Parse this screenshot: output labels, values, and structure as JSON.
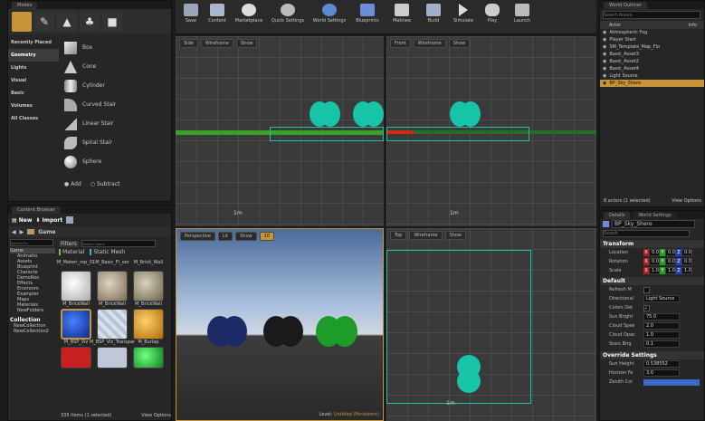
{
  "modes": {
    "title": "Modes",
    "categories": [
      "Recently Placed",
      "Geometry",
      "Lights",
      "Visual",
      "Basic",
      "Volumes",
      "All Classes"
    ],
    "selected_category": "Geometry",
    "items": [
      "Box",
      "Cone",
      "Cylinder",
      "Curved Stair",
      "Linear Stair",
      "Spiral Stair",
      "Sphere"
    ],
    "add_label": "Add",
    "subtract_label": "Subtract"
  },
  "toolbar": {
    "buttons": [
      "Save",
      "Content",
      "Marketplace",
      "Quick Settings",
      "World Settings",
      "Blueprints",
      "Matinee",
      "Build",
      "Simulate",
      "Play",
      "Launch"
    ]
  },
  "viewports": {
    "side": {
      "mode": "Side",
      "view": "Wireframe",
      "show": "Show"
    },
    "front": {
      "mode": "Front",
      "view": "Wireframe",
      "show": "Show"
    },
    "perspective": {
      "mode": "Perspective",
      "view": "Lit",
      "show": "Show",
      "snap": "10",
      "level_label": "Level:",
      "level_value": "Untitled (Persistent)"
    },
    "top": {
      "mode": "Top",
      "view": "Wireframe",
      "show": "Show"
    },
    "scale_label": "1m"
  },
  "content_browser": {
    "title": "Content Browser",
    "new_label": "New",
    "import_label": "Import",
    "path": "Game",
    "search_folders_placeholder": "Search Fo",
    "filters_label": "Filters",
    "search_assets_placeholder": "Search Game",
    "folders": [
      "Game",
      "Animatio",
      "Assets",
      "Blueprint",
      "Characte",
      "DemoRoo",
      "Effects",
      "Environm",
      "Exampler",
      "Maps",
      "Materials",
      "NewFolders"
    ],
    "collections_label": "Collection",
    "collections": [
      "NewCollection",
      "NewCollection2"
    ],
    "columns": [
      "Material",
      "Static Mesh"
    ],
    "partial_row": [
      "M_Materi_rop_01",
      "M_Basic_Fl_oor",
      "M_Brick_Wall"
    ],
    "assets": [
      {
        "name": "M_BrickWall",
        "color": "#e8e8e8"
      },
      {
        "name": "M_BrickWall",
        "color": "#c9b9a2"
      },
      {
        "name": "M_BrickWall",
        "color": "#b9b39a"
      },
      {
        "name": "M_BSP_Viz",
        "color": "#1a4bd6"
      },
      {
        "name": "M_BSP_Viz_Transpar",
        "color": "#b9c3d6"
      },
      {
        "name": "M_Burlap",
        "color": "#f0a020"
      },
      {
        "name": "",
        "color": "#c82020"
      },
      {
        "name": "",
        "color": "#c0c8d8"
      },
      {
        "name": "",
        "color": "#28d040"
      }
    ],
    "status": "335 items (1 selected)",
    "view_options": "View Options"
  },
  "world_outliner": {
    "title": "World Outliner",
    "search_placeholder": "Search Actors",
    "col_actor": "Actor",
    "col_info": "Info",
    "actors": [
      "Atmospheric Fog",
      "Player Start",
      "SM_Template_Map_Flo",
      "Basic_Asset3",
      "Basic_Asset2",
      "Basic_Asset4",
      "Light Source",
      "BP_Sky_Shere"
    ],
    "selected_actor": "BP_Sky_Shere",
    "status": "8 actors (1 selected)",
    "view_options": "View Options"
  },
  "details": {
    "tab_details": "Details",
    "tab_world": "World Settings",
    "object_name": "BP_Sky_Shere",
    "search_placeholder": "Search",
    "transform_header": "Transform",
    "location_label": "Location",
    "rotation_label": "Rotation",
    "scale_label": "Scale",
    "location": [
      "0.0",
      "0.0",
      "0.0"
    ],
    "rotation": [
      "0.0",
      "0.0",
      "0.0"
    ],
    "scale": [
      "1.0",
      "1.0",
      "1.0"
    ],
    "default_header": "Default",
    "refresh_label": "Refresh M",
    "directional_label": "Directional",
    "directional_value": "Light Source",
    "colors_label": "Colors Det",
    "sun_label": "Sun Bright",
    "sun_value": "75.0",
    "cloud_speed_label": "Cloud Spee",
    "cloud_speed_value": "2.0",
    "cloud_opac_label": "Cloud Opac",
    "cloud_opac_value": "1.0",
    "stars_label": "Stars Brig",
    "stars_value": "0.1",
    "override_header": "Override Settings",
    "sun_height_label": "Sun Height",
    "sun_height_value": "0.538552",
    "horizon_label": "Horizon Fa",
    "horizon_value": "3.0",
    "zenith_label": "Zenith Col"
  },
  "colors": {
    "accent": "#f0a020",
    "selection": "#c8943a",
    "cyan": "#18c4a8",
    "green_line": "#3aa02a",
    "red_line": "#d02a1a"
  }
}
